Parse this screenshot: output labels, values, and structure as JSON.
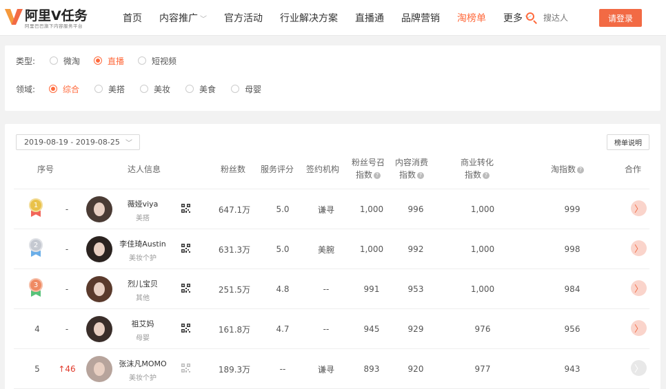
{
  "header": {
    "logo_text": "阿里V任务",
    "logo_sub": "阿里巴巴旗下内容服务平台",
    "nav": [
      {
        "label": "首页",
        "has_menu": false,
        "active": false
      },
      {
        "label": "内容推广",
        "has_menu": true,
        "active": false
      },
      {
        "label": "官方活动",
        "has_menu": false,
        "active": false
      },
      {
        "label": "行业解决方案",
        "has_menu": false,
        "active": false
      },
      {
        "label": "直播通",
        "has_menu": false,
        "active": false
      },
      {
        "label": "品牌营销",
        "has_menu": false,
        "active": false
      },
      {
        "label": "淘榜单",
        "has_menu": false,
        "active": true
      },
      {
        "label": "更多",
        "has_menu": true,
        "active": false
      }
    ],
    "search_placeholder": "搜达人",
    "login_label": "请登录",
    "accent_color": "#f26a44"
  },
  "filters": {
    "type_label": "类型:",
    "type_options": [
      "微淘",
      "直播",
      "短视频"
    ],
    "type_selected": "直播",
    "domain_label": "领域:",
    "domain_options": [
      "综合",
      "美搭",
      "美妆",
      "美食",
      "母婴"
    ],
    "domain_selected": "综合"
  },
  "toolbar": {
    "date_range": "2019-08-19 - 2019-08-25",
    "rank_note_label": "榜单说明"
  },
  "table": {
    "headers": {
      "rank": "序号",
      "influencer": "达人信息",
      "fans": "粉丝数",
      "service": "服务评分",
      "agency": "签约机构",
      "fan_recall_1": "粉丝号召",
      "fan_recall_2": "指数",
      "content_1": "内容消费",
      "content_2": "指数",
      "conversion_1": "商业转化",
      "conversion_2": "指数",
      "tao_index": "淘指数",
      "cooperate": "合作"
    },
    "rows": [
      {
        "rank": "1",
        "medal": "gold",
        "trend": "-",
        "name": "薇娅viya",
        "category": "美搭",
        "fans": "647.1万",
        "service": "5.0",
        "agency": "谦寻",
        "recall": "1,000",
        "content": "996",
        "conversion": "1,000",
        "tao_index": "999",
        "can_cooperate": true
      },
      {
        "rank": "2",
        "medal": "silver",
        "trend": "-",
        "name": "李佳琦Austin",
        "category": "美妆个护",
        "fans": "631.3万",
        "service": "5.0",
        "agency": "美腕",
        "recall": "1,000",
        "content": "992",
        "conversion": "1,000",
        "tao_index": "998",
        "can_cooperate": true
      },
      {
        "rank": "3",
        "medal": "bronze",
        "trend": "-",
        "name": "烈儿宝贝",
        "category": "其他",
        "fans": "251.5万",
        "service": "4.8",
        "agency": "--",
        "recall": "991",
        "content": "953",
        "conversion": "1,000",
        "tao_index": "984",
        "can_cooperate": true
      },
      {
        "rank": "4",
        "medal": "none",
        "trend": "-",
        "name": "祖艾妈",
        "category": "母婴",
        "fans": "161.8万",
        "service": "4.7",
        "agency": "--",
        "recall": "945",
        "content": "929",
        "conversion": "976",
        "tao_index": "956",
        "can_cooperate": true
      },
      {
        "rank": "5",
        "medal": "none",
        "trend": "↑46",
        "name": "张沫凡MOMO",
        "category": "美妆个护",
        "fans": "189.3万",
        "service": "--",
        "agency": "谦寻",
        "recall": "893",
        "content": "920",
        "conversion": "977",
        "tao_index": "943",
        "can_cooperate": false
      }
    ]
  }
}
